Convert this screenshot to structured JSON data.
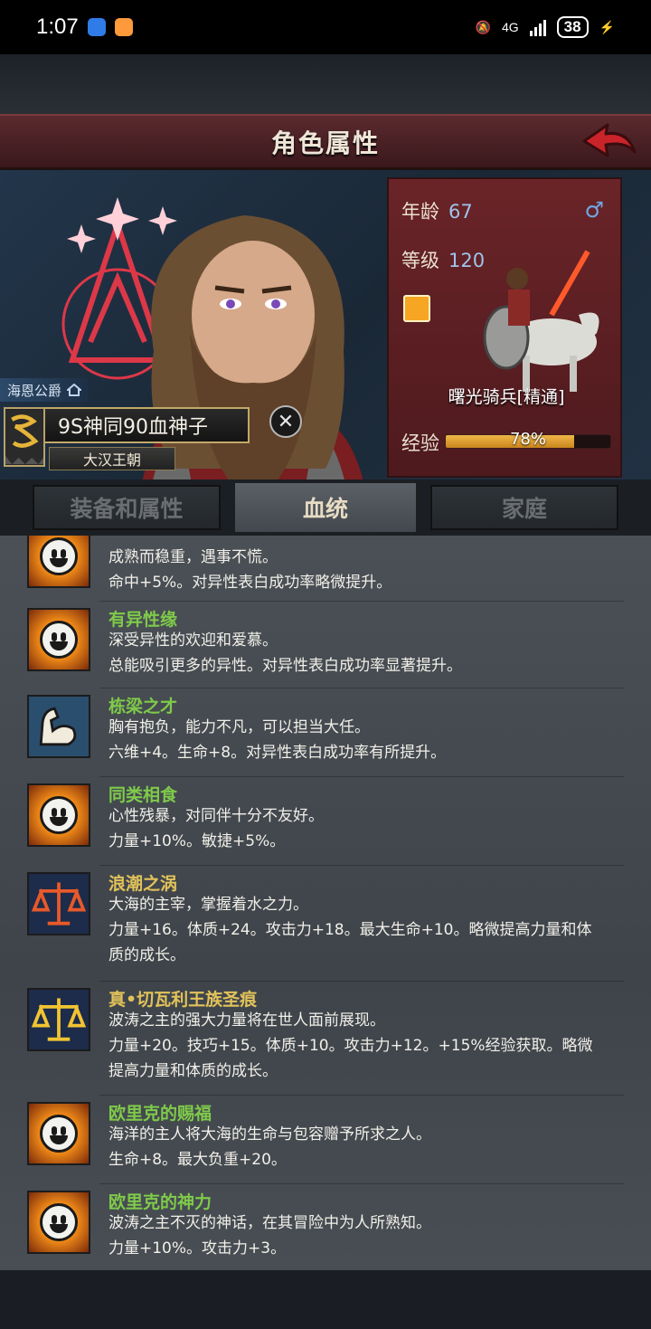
{
  "status_bar": {
    "time": "1:07",
    "network": "4G",
    "battery": "38"
  },
  "header": {
    "title": "角色属性"
  },
  "character": {
    "noble_title": "海恩公爵",
    "name": "9S神同90血神子",
    "dynasty": "大汉王朝"
  },
  "info": {
    "age_label": "年龄",
    "age": "67",
    "gender_symbol": "♂",
    "level_label": "等级",
    "level": "120",
    "unit_name": "曙光骑兵[精通]",
    "exp_label": "经验",
    "exp_text": "78%",
    "exp_progress": 0.78
  },
  "tabs": [
    {
      "label": "装备和属性"
    },
    {
      "label": "血统"
    },
    {
      "label": "家庭"
    }
  ],
  "traits": [
    {
      "name": "",
      "icon": "smiley-sun-icon",
      "line1": "成熟而稳重，遇事不慌。",
      "line2": "命中+5%。对异性表白成功率略微提升。"
    },
    {
      "name": "有异性缘",
      "icon": "smiley-sun-icon",
      "line1": "深受异性的欢迎和爱慕。",
      "line2": "总能吸引更多的异性。对异性表白成功率显著提升。"
    },
    {
      "name": "栋梁之才",
      "icon": "muscle-arm-icon",
      "line1": "胸有抱负，能力不凡，可以担当大任。",
      "line2": "六维+4。生命+8。对异性表白成功率有所提升。"
    },
    {
      "name": "同类相食",
      "icon": "smiley-sun-icon",
      "line1": "心性残暴，对同伴十分不友好。",
      "line2": "力量+10%。敏捷+5%。"
    },
    {
      "name": "浪潮之涡",
      "icon": "red-scale-icon",
      "line1": "大海的主宰，掌握着水之力。",
      "line2": "力量+16。体质+24。攻击力+18。最大生命+10。略微提高力量和体",
      "line3": "质的成长。"
    },
    {
      "name": "真•切瓦利王族圣痕",
      "icon": "gold-scale-icon",
      "line1": "波涛之主的强大力量将在世人面前展现。",
      "line2": "力量+20。技巧+15。体质+10。攻击力+12。+15%经验获取。略微",
      "line3": "提高力量和体质的成长。"
    },
    {
      "name": "欧里克的赐福",
      "icon": "smiley-sun-icon",
      "line1": "海洋的主人将大海的生命与包容赠予所求之人。",
      "line2": "生命+8。最大负重+20。"
    },
    {
      "name": "欧里克的神力",
      "icon": "smiley-sun-icon",
      "line1": "波涛之主不灭的神话，在其冒险中为人所熟知。",
      "line2": "力量+10%。攻击力+3。"
    }
  ]
}
